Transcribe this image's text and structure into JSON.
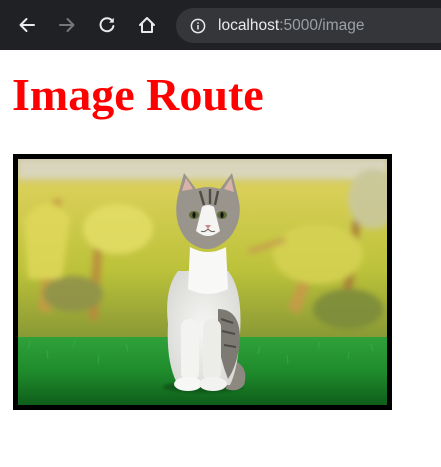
{
  "browser": {
    "address_bar": {
      "host": "localhost",
      "path": ":5000/image"
    },
    "icons": {
      "back": "arrow-left-icon",
      "forward": "arrow-right-icon",
      "reload": "reload-icon",
      "home": "home-icon",
      "site_info": "info-icon"
    },
    "colors": {
      "toolbar": "#202124",
      "omnibox": "#35363a"
    }
  },
  "page": {
    "heading": "Image Route",
    "heading_color": "#ff0000",
    "image": {
      "subject": "kitten sitting on grass"
    }
  }
}
